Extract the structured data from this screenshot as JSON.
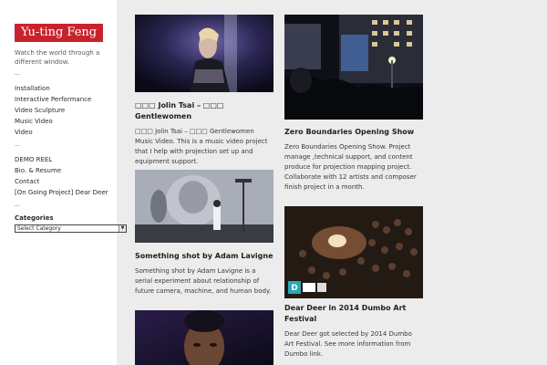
{
  "site": {
    "title": "Yu-ting Feng",
    "tagline": "Watch the world through a different window."
  },
  "nav": {
    "group1": [
      "Installation",
      "Interactive Performance",
      "Video Sculpture",
      "Music Video",
      "Video"
    ],
    "group2": [
      "DEMO REEL",
      "Bio. & Resume",
      "Contact",
      "[On Going Project] Dear Deer"
    ]
  },
  "categories": {
    "title": "Categories",
    "selected": "Select Category"
  },
  "posts": [
    {
      "title": "□□□ Jolin Tsai – □□□ Gentlewomen",
      "excerpt": "□□□ Jolin Tsai – □□□ Gentlewomen Music Video. This is a music video project that I help with projection set up and equipment support."
    },
    {
      "title": "Zero Boundaries Opening Show",
      "excerpt": "Zero Boundaries Opening Show. Project manage ,technical support, and content produce for projection mapping project. Collaborate with 12 artists and composer finish project in a month."
    },
    {
      "title": "Something shot by Adam Lavigne",
      "excerpt": "Something shot by Adam Lavigne is a serial experiment about relationship of future camera, machine, and human body."
    },
    {
      "title": "Dear Deer in 2014 Dumbo Art Festival",
      "excerpt": "Dear Deer got selected by 2014 Dumbo Art Festival. See more information from Dumbo link."
    },
    {
      "title": "",
      "excerpt": ""
    }
  ],
  "colors": {
    "brand": "#c8232c",
    "page_bg": "#ececec",
    "sidebar_bg": "#ffffff"
  }
}
